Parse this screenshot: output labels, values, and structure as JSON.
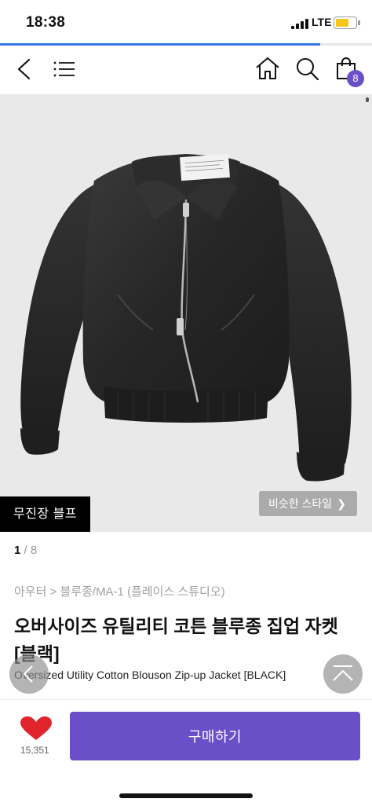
{
  "status_bar": {
    "time": "18:38",
    "network": "LTE",
    "battery_level": 0.7,
    "battery_color": "#f5c518"
  },
  "page_load_progress": 0.86,
  "nav": {
    "back_icon": "chevron-left-icon",
    "menu_icon": "hamburger-menu-icon",
    "home_icon": "home-icon",
    "search_icon": "search-icon",
    "cart_icon": "shopping-bag-icon",
    "cart_count": "8"
  },
  "gallery": {
    "store_tag": "무진장 블프",
    "similar_style_label": "비슷한 스타일",
    "current_index": "1",
    "separator": " / ",
    "total": "8"
  },
  "product": {
    "breadcrumb": "아우터 > 블루종/MA-1 (플레이스 스튜디오)",
    "title": "오버사이즈 유틸리티 코튼 블루종 집업 자켓 [블랙]",
    "subtitle": "Oversized Utility Cotton Blouson Zip-up Jacket [BLACK]"
  },
  "floating": {
    "prev_icon": "chevron-left-icon",
    "top_icon": "scroll-to-top-icon"
  },
  "bottom_bar": {
    "like_icon": "heart-icon",
    "like_count": "15,351",
    "buy_label": "구매하기"
  },
  "colors": {
    "accent": "#6b4fc8",
    "like": "#e0242b",
    "progress": "#3573e6"
  }
}
